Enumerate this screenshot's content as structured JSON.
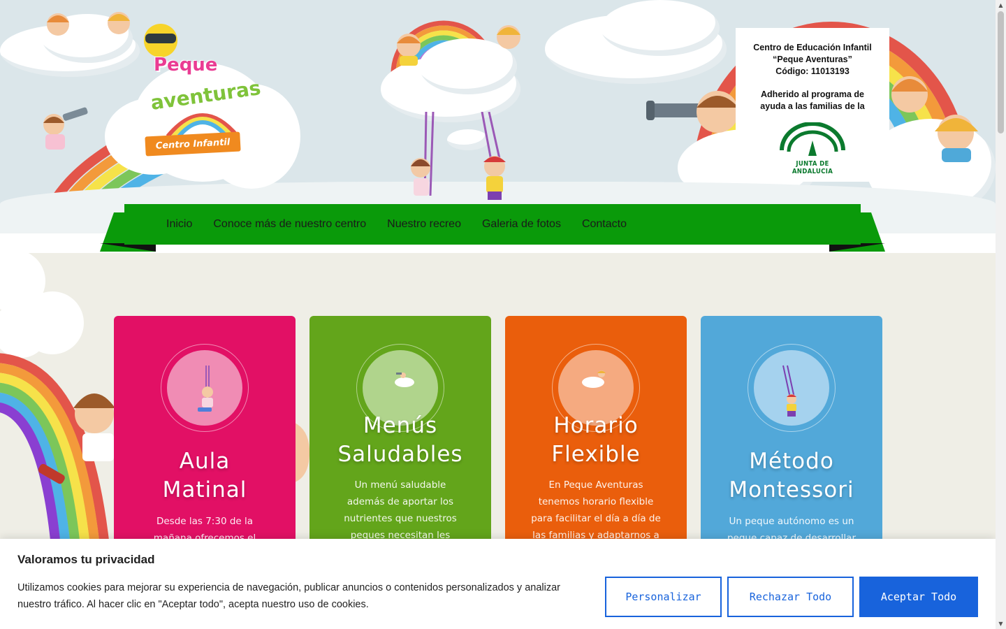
{
  "header": {
    "logo": {
      "line1": "Peque",
      "line2": "aventuras",
      "banner": "Centro Infantil"
    },
    "info_box": {
      "line1": "Centro de Educación Infantil",
      "line2": "“Peque Aventuras”",
      "line3": "Código: 11013193",
      "line4": "Adherido al programa de",
      "line5": "ayuda a las familias de la",
      "junta_label": "JUNTA DE ANDALUCIA"
    }
  },
  "nav": {
    "items": [
      {
        "label": "Inicio"
      },
      {
        "label": "Conoce más de nuestro centro"
      },
      {
        "label": "Nuestro recreo"
      },
      {
        "label": "Galeria de fotos"
      },
      {
        "label": "Contacto"
      }
    ],
    "color": "#0a9a0a"
  },
  "cards": [
    {
      "title_l1": "Aula",
      "title_l2": "Matinal",
      "text_l1": "Desde las 7:30 de la",
      "text_l2": "mañana ofrecemos el",
      "color": "#e21065",
      "circle": "#f08cb4",
      "icon": "girl-swing-icon"
    },
    {
      "title_l1": "Menús",
      "title_l2": "Saludables",
      "text_l1": "Un menú saludable",
      "text_l2": "además de aportar los",
      "text_l3": "nutrientes que nuestros",
      "text_l4": "peques necesitan les",
      "color": "#63a51b",
      "circle": "#b0d48c",
      "icon": "telescope-cloud-icon"
    },
    {
      "title_l1": "Horario",
      "title_l2": "Flexible",
      "text_l1": "En Peque Aventuras",
      "text_l2": "tenemos horario flexible",
      "text_l3": "para facilitar el día a día de",
      "text_l4": "las familias y adaptarnos a",
      "color": "#ea5e0c",
      "circle": "#f5aa80",
      "icon": "kid-cloud-icon"
    },
    {
      "title_l1": "Método",
      "title_l2": "Montessori",
      "text_l1": "Un peque autónomo es un",
      "text_l2": "peque capaz de desarrollar",
      "color": "#52a8d9",
      "circle": "#a5d2ee",
      "icon": "boy-swing-icon"
    }
  ],
  "cookie": {
    "title": "Valoramos tu privacidad",
    "text": "Utilizamos cookies para mejorar su experiencia de navegación, publicar anuncios o contenidos personalizados y analizar nuestro tráfico. Al hacer clic en \"Aceptar todo\", acepta nuestro uso de cookies.",
    "customize_label": "Personalizar",
    "reject_label": "Rechazar Todo",
    "accept_label": "Aceptar Todo",
    "accent": "#1863dc"
  }
}
